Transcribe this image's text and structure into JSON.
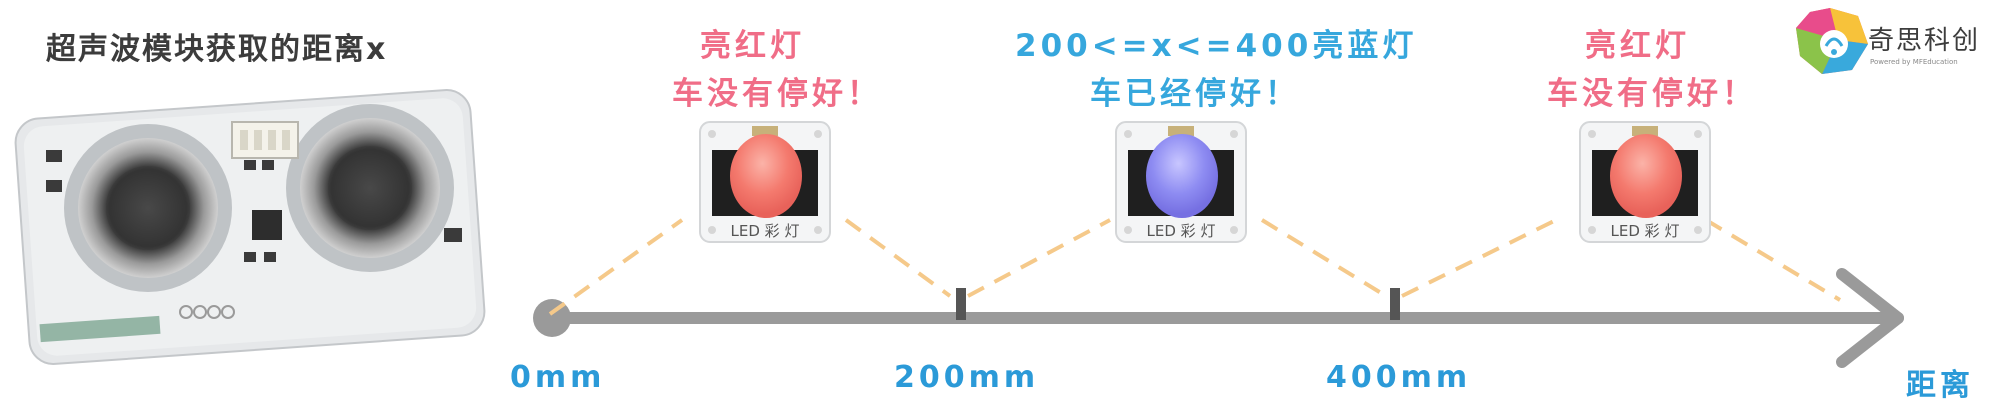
{
  "title": "超声波模块获取的距离x",
  "zones": [
    {
      "line1": "亮红灯",
      "line2": "车没有停好！",
      "light": "red"
    },
    {
      "line1": "200<=x<=400亮蓝灯",
      "line2": "车已经停好！",
      "light": "blue"
    },
    {
      "line1": "亮红灯",
      "line2": "车没有停好！",
      "light": "red"
    }
  ],
  "axis": {
    "ticks": [
      "0mm",
      "200mm",
      "400mm"
    ],
    "end_label": "距离"
  },
  "module_label": "LED 彩 灯",
  "brand": {
    "name": "奇思科创",
    "tagline": "Powered by MFEducation"
  },
  "colors": {
    "pink_text": "#f06d87",
    "blue_text": "#36a7dd",
    "axis": "#9a9a9a",
    "dash": "#f5c98a",
    "red_light": "#f47a6e",
    "blue_light": "#8e8cf2"
  }
}
